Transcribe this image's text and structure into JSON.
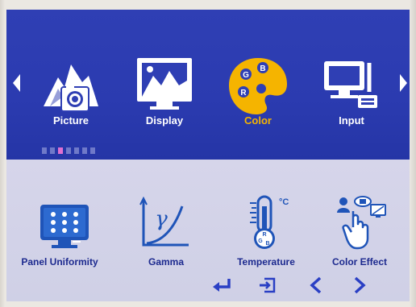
{
  "menu": {
    "items": [
      {
        "label": "Picture",
        "icon": "picture-icon"
      },
      {
        "label": "Display",
        "icon": "display-icon"
      },
      {
        "label": "Color",
        "icon": "palette-icon",
        "selected": true
      },
      {
        "label": "Input",
        "icon": "input-icon"
      }
    ],
    "page_dots": {
      "count": 7,
      "active_index": 2
    }
  },
  "palette_letters": {
    "g": "G",
    "b": "B",
    "r": "R"
  },
  "submenu": {
    "items": [
      {
        "label": "Panel Uniformity",
        "icon": "panel-uniformity-icon"
      },
      {
        "label": "Gamma",
        "icon": "gamma-icon",
        "symbol": "γ"
      },
      {
        "label": "Temperature",
        "icon": "thermometer-icon",
        "unit": "°C",
        "letters": [
          "R",
          "G",
          "B"
        ]
      },
      {
        "label": "Color Effect",
        "icon": "color-effect-icon"
      }
    ]
  },
  "nav": {
    "enter_icon": "enter-icon",
    "exit_icon": "exit-icon",
    "prev_icon": "chevron-left-icon",
    "next_icon": "chevron-right-icon"
  },
  "colors": {
    "top_panel": "#2f3fb4",
    "bottom_panel": "#d2d2e8",
    "highlight": "#f5b400",
    "icon_blue": "#1f54b8",
    "nav_blue": "#2a3fc4"
  }
}
